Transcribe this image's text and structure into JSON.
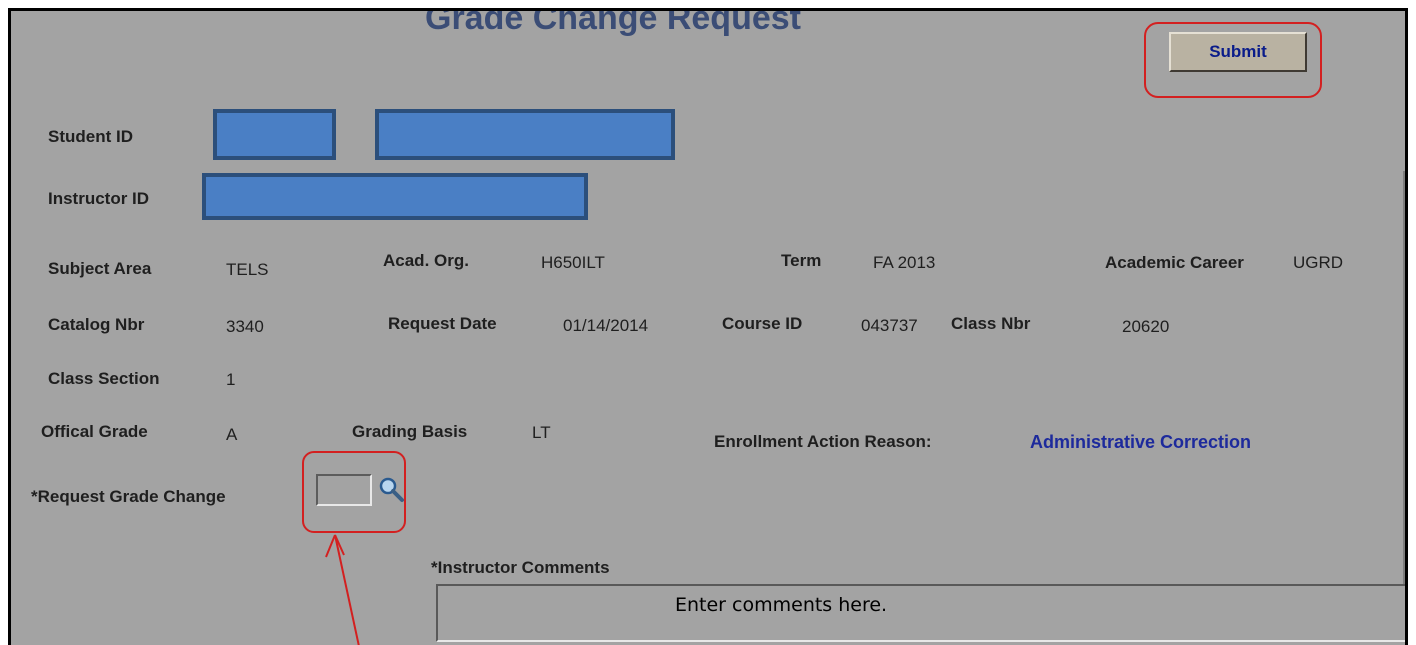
{
  "page": {
    "title": "Grade Change Request",
    "submit_label": "Submit"
  },
  "fields": {
    "student_id_label": "Student ID",
    "instructor_id_label": "Instructor ID",
    "subject_area_label": "Subject Area",
    "subject_area_value": "TELS",
    "acad_org_label": "Acad. Org.",
    "acad_org_value": "H650ILT",
    "term_label": "Term",
    "term_value": "FA 2013",
    "career_label": "Academic Career",
    "career_value": "UGRD",
    "catalog_label": "Catalog Nbr",
    "catalog_value": "3340",
    "request_date_label": "Request Date",
    "request_date_value": "01/14/2014",
    "course_id_label": "Course ID",
    "course_id_value": "043737",
    "class_nbr_label": "Class Nbr",
    "class_nbr_value": "20620",
    "class_section_label": "Class Section",
    "class_section_value": "1",
    "official_grade_label": "Offical Grade",
    "official_grade_value": "A",
    "grading_basis_label": "Grading Basis",
    "grading_basis_value": "LT",
    "enroll_reason_label": "Enrollment Action Reason:",
    "enroll_reason_value": "Administrative Correction",
    "request_grade_label": "*Request Grade Change",
    "request_grade_value": "",
    "comments_label": "*Instructor Comments",
    "comments_placeholder": "Enter comments here."
  },
  "icons": {
    "lookup": "magnifier-icon"
  },
  "colors": {
    "background": "#a3a3a3",
    "title": "#3b4d76",
    "link": "#1d2a9c",
    "redaction": "#4a7fc5",
    "callout": "#d32020"
  }
}
